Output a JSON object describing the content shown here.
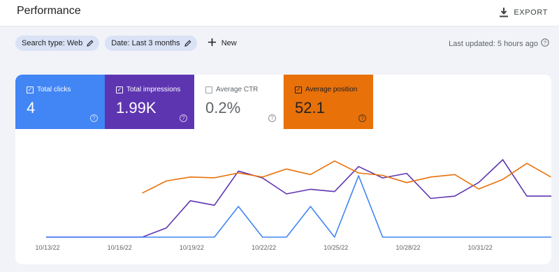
{
  "header": {
    "title": "Performance",
    "export_label": "EXPORT",
    "export_icon": "download-icon"
  },
  "filters": {
    "search_type": "Search type: Web",
    "date": "Date: Last 3 months",
    "new_label": "New",
    "edit_icon": "pencil-icon",
    "new_icon": "plus-icon"
  },
  "status": {
    "last_updated": "Last updated: 5 hours ago",
    "help_icon": "help-icon"
  },
  "metrics": [
    {
      "label": "Total clicks",
      "value": "4",
      "checked": true,
      "color": "#4285f4"
    },
    {
      "label": "Total impressions",
      "value": "1.99K",
      "checked": true,
      "color": "#5e35b1"
    },
    {
      "label": "Average CTR",
      "value": "0.2%",
      "checked": false,
      "color": "#ffffff"
    },
    {
      "label": "Average position",
      "value": "52.1",
      "checked": true,
      "color": "#e8710a"
    }
  ],
  "chart_data": {
    "type": "line",
    "x_tick_labels": [
      "10/13/22",
      "10/16/22",
      "10/19/22",
      "10/22/22",
      "10/25/22",
      "10/28/22",
      "10/31/22"
    ],
    "x_tick_day_index": [
      0,
      3,
      6,
      9,
      12,
      15,
      18
    ],
    "grid": false,
    "series": [
      {
        "name": "Total impressions",
        "color": "#5e35b1",
        "values": [
          0,
          0,
          0,
          0,
          0,
          4,
          16,
          14,
          29,
          26,
          19,
          21,
          20,
          31,
          26,
          28,
          17,
          18,
          24,
          34,
          18,
          18,
          20,
          14
        ]
      },
      {
        "name": "Total clicks",
        "color": "#4285f4",
        "values": [
          0,
          0,
          0,
          0,
          0,
          0,
          0,
          0,
          1,
          0,
          0,
          1,
          0,
          2,
          0,
          0,
          0,
          0,
          0,
          0,
          0,
          0,
          0,
          0
        ]
      },
      {
        "name": "Average position",
        "color": "#e8710a",
        "values": [
          null,
          null,
          null,
          null,
          55,
          70,
          75,
          74,
          80,
          75,
          85,
          78,
          95,
          80,
          77,
          68,
          75,
          78,
          60,
          72,
          92,
          75
        ]
      }
    ]
  }
}
